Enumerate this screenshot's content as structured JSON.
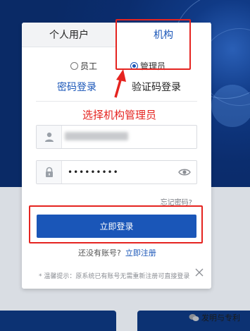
{
  "tabs": {
    "personal": "个人用户",
    "org": "机构"
  },
  "roles": {
    "employee": "员工",
    "admin": "管理员",
    "selected": "管理员"
  },
  "login_modes": {
    "password": "密码登录",
    "code": "验证码登录"
  },
  "annotation": {
    "caption": "选择机构管理员"
  },
  "password_field": {
    "masked_value": "•••••••••"
  },
  "links": {
    "forgot": "忘记密码?"
  },
  "buttons": {
    "login": "立即登录"
  },
  "register": {
    "prompt": "还没有账号?",
    "link": "立即注册"
  },
  "tip": "* 温馨提示：原系统已有账号无需重新注册可直接登录",
  "watermark": "发明与专利",
  "colors": {
    "accent": "#1a56b8",
    "annotation_red": "#e52420",
    "background_dark": "#0c3273"
  }
}
